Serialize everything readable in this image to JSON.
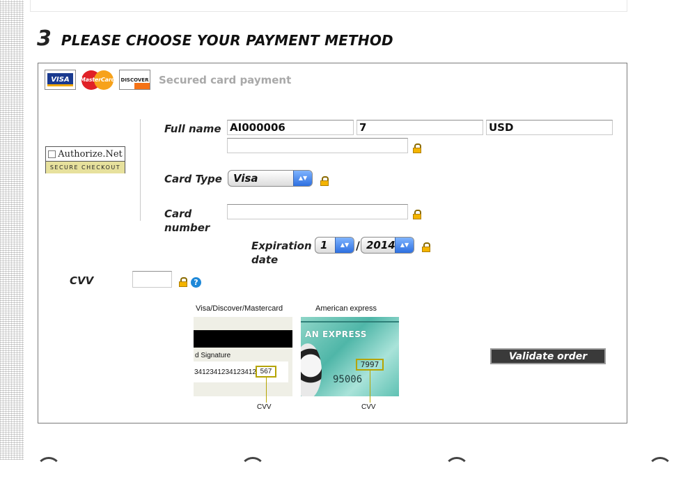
{
  "section": {
    "step_number": "3",
    "title": "PLEASE CHOOSE YOUR PAYMENT METHOD"
  },
  "payment": {
    "secured_label": "Secured card payment",
    "card_logos": [
      {
        "name": "visa-logo",
        "text": "VISA"
      },
      {
        "name": "mastercard-logo",
        "text": "MasterCard"
      },
      {
        "name": "discover-logo",
        "text": "DISCOVER"
      }
    ],
    "badge": {
      "brand": "Authorize.Net",
      "tagline": "SECURE CHECKOUT"
    },
    "fields": {
      "full_name_label": "Full name",
      "order_ref": "AI000006",
      "quantity": "7",
      "currency": "USD",
      "full_name_value": "",
      "card_type_label": "Card Type",
      "card_type_value": "Visa",
      "card_number_label": "Card number",
      "card_number_value": "",
      "expiration_label": "Expiration date",
      "exp_month": "1",
      "exp_separator": "/",
      "exp_year": "2014",
      "cvv_label": "CVV",
      "cvv_value": ""
    },
    "cvv_help": {
      "visa_caption": "Visa/Discover/Mastercard",
      "visa_signature": "d Signature",
      "visa_number": "341234123412341234",
      "visa_cvv": "567",
      "amex_caption": "American express",
      "amex_title": "AN EXPRESS",
      "amex_cvv": "7997",
      "amex_number": "95006",
      "cvv_pointer_label": "CVV"
    },
    "validate_label": "Validate order"
  }
}
